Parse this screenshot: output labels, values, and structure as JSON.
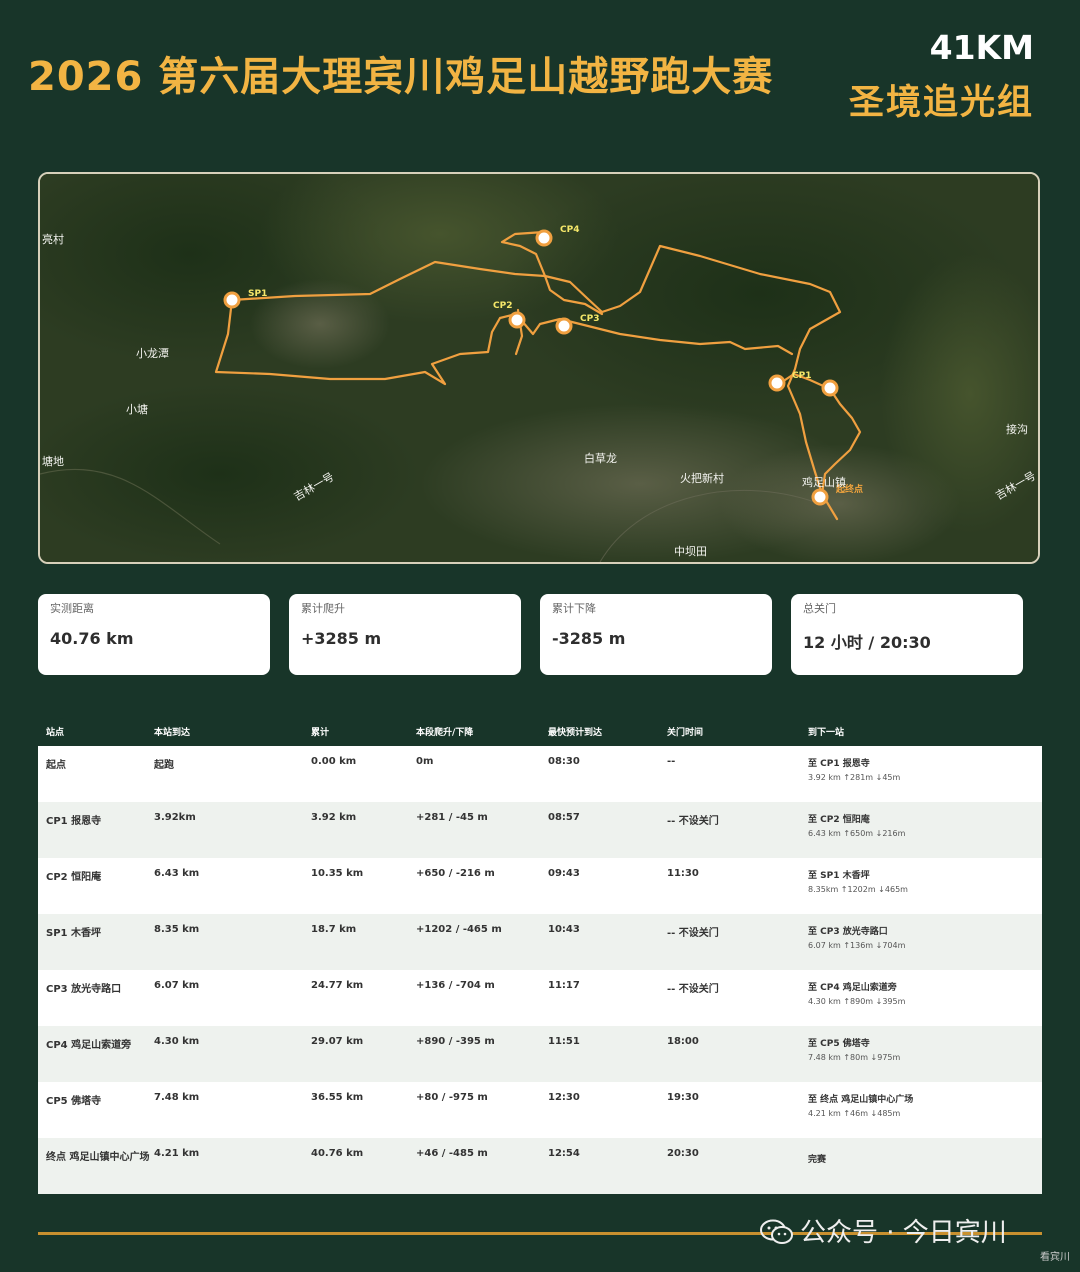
{
  "header": {
    "title": "2026 第六届大理宾川鸡足山越野跑大赛",
    "distance": "41KM",
    "group": "圣境追光组"
  },
  "map": {
    "places": [
      "亮村",
      "小龙潭",
      "小塘",
      "塘地",
      "吉林一号",
      "白草龙",
      "火把新村",
      "中坝田",
      "鸡足山镇",
      "接沟",
      "吉林一号"
    ],
    "checkpoints": [
      "SP1",
      "CP2",
      "CP3",
      "CP4",
      "CP1"
    ],
    "start_label": "起终点",
    "route_color": "#f0a040",
    "marker_color": "#ffffff"
  },
  "stats": [
    {
      "label": "实测距离",
      "value": "40.76 km"
    },
    {
      "label": "累计爬升",
      "value": "+3285 m"
    },
    {
      "label": "累计下降",
      "value": "-3285 m"
    },
    {
      "label": "总关门",
      "value": "12 小时 / 20:30"
    }
  ],
  "table": {
    "headers": [
      "站点",
      "本站到达",
      "累计",
      "本段爬升/下降",
      "最快预计到达",
      "关门时间",
      "到下一站"
    ],
    "rows": [
      {
        "station": "起点",
        "segment": "起跑",
        "cumulative": "0.00 km",
        "elevation": "0m",
        "fastest": "08:30",
        "cutoff": "--",
        "next_title": "至 CP1 报恩寺",
        "next_detail": "3.92 km ↑281m ↓45m"
      },
      {
        "station": "CP1 报恩寺",
        "segment": "3.92km",
        "cumulative": "3.92 km",
        "elevation": "+281 / -45 m",
        "fastest": "08:57",
        "cutoff": "-- 不设关门",
        "next_title": "至 CP2 恒阳庵",
        "next_detail": "6.43 km ↑650m ↓216m"
      },
      {
        "station": "CP2 恒阳庵",
        "segment": "6.43 km",
        "cumulative": "10.35 km",
        "elevation": "+650 / -216 m",
        "fastest": "09:43",
        "cutoff": "11:30",
        "next_title": "至 SP1 木香坪",
        "next_detail": "8.35km ↑1202m ↓465m"
      },
      {
        "station": "SP1 木香坪",
        "segment": "8.35 km",
        "cumulative": "18.7 km",
        "elevation": "+1202 / -465 m",
        "fastest": "10:43",
        "cutoff": "-- 不设关门",
        "next_title": "至 CP3 放光寺路口",
        "next_detail": "6.07 km ↑136m ↓704m"
      },
      {
        "station": "CP3 放光寺路口",
        "segment": "6.07 km",
        "cumulative": "24.77 km",
        "elevation": "+136 / -704 m",
        "fastest": "11:17",
        "cutoff": "-- 不设关门",
        "next_title": "至 CP4 鸡足山索道旁",
        "next_detail": "4.30 km ↑890m ↓395m"
      },
      {
        "station": "CP4 鸡足山索道旁",
        "segment": "4.30 km",
        "cumulative": "29.07 km",
        "elevation": "+890 / -395 m",
        "fastest": "11:51",
        "cutoff": "18:00",
        "next_title": "至 CP5 佛塔寺",
        "next_detail": "7.48 km ↑80m ↓975m"
      },
      {
        "station": "CP5 佛塔寺",
        "segment": "7.48 km",
        "cumulative": "36.55 km",
        "elevation": "+80 / -975 m",
        "fastest": "12:30",
        "cutoff": "19:30",
        "next_title": "至 终点 鸡足山镇中心广场",
        "next_detail": "4.21 km ↑46m ↓485m"
      },
      {
        "station": "终点 鸡足山镇中心广场",
        "segment": "4.21 km",
        "cumulative": "40.76 km",
        "elevation": "+46 / -485 m",
        "fastest": "12:54",
        "cutoff": "20:30",
        "next_title": "完赛",
        "next_detail": ""
      }
    ]
  },
  "watermark": {
    "text": "公众号 · 今日宾川",
    "small": "看宾川"
  }
}
